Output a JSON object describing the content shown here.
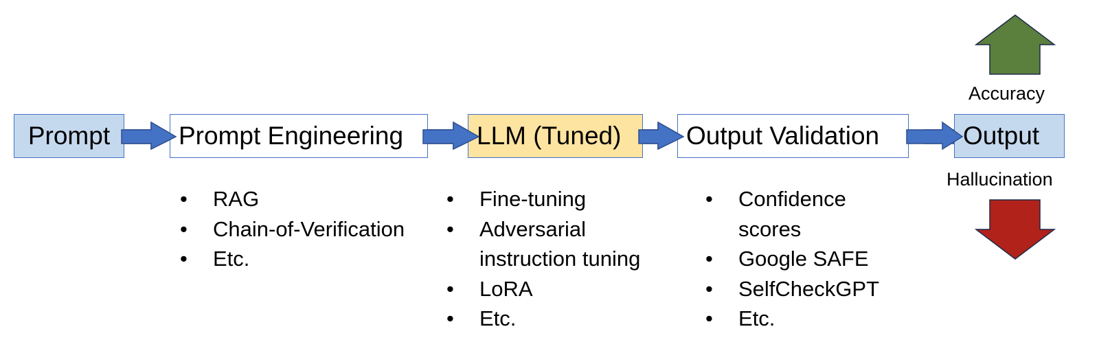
{
  "diagram": {
    "type": "flowchart",
    "stages": [
      {
        "id": "prompt",
        "label": "Prompt",
        "fill": "#c5d9ee"
      },
      {
        "id": "prompt_engineering",
        "label": "Prompt Engineering",
        "fill": "#ffffff"
      },
      {
        "id": "llm",
        "label": "LLM (Tuned)",
        "fill": "#fde4a0"
      },
      {
        "id": "output_validation",
        "label": "Output Validation",
        "fill": "#ffffff"
      },
      {
        "id": "output",
        "label": "Output",
        "fill": "#c5d9ee"
      }
    ],
    "edges": [
      {
        "from": "prompt",
        "to": "prompt_engineering"
      },
      {
        "from": "prompt_engineering",
        "to": "llm"
      },
      {
        "from": "llm",
        "to": "output_validation"
      },
      {
        "from": "output_validation",
        "to": "output"
      }
    ],
    "lists": {
      "prompt_engineering": [
        "RAG",
        "Chain-of-Verification",
        "Etc."
      ],
      "llm": [
        "Fine-tuning",
        "Adversarial instruction tuning",
        "LoRA",
        "Etc."
      ],
      "output_validation": [
        "Confidence scores",
        "Google SAFE",
        "SelfCheckGPT",
        "Etc."
      ]
    },
    "indicators": {
      "accuracy": {
        "label": "Accuracy",
        "direction": "up",
        "color": "#5b7f3c"
      },
      "hallucination": {
        "label": "Hallucination",
        "direction": "down",
        "color": "#b0221a"
      }
    },
    "colors": {
      "arrow_fill": "#4472c4",
      "arrow_stroke": "#2f4f8f",
      "box_border": "#4472c4"
    }
  }
}
